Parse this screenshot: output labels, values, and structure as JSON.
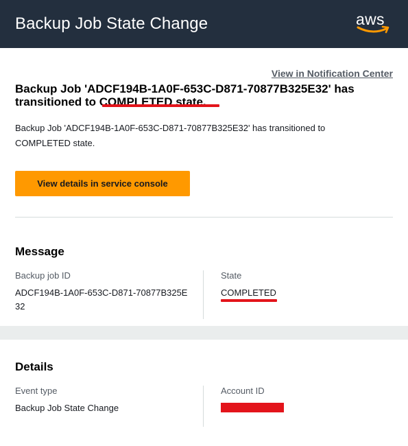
{
  "header": {
    "title": "Backup Job State Change",
    "logo_text": "aws"
  },
  "notification_link": "View in Notification Center",
  "headline": {
    "prefix": "Backup Job 'ADCF194B-1A0F-653C-D871-70877B325E32' has transitioned to ",
    "state_phrase": "COMPLETED state."
  },
  "body_text": "Backup Job 'ADCF194B-1A0F-653C-D871-70877B325E32' has transitioned to COMPLETED state.",
  "cta_button": "View details in service console",
  "message": {
    "title": "Message",
    "backup_job_id_label": "Backup job ID",
    "backup_job_id_value": "ADCF194B-1A0F-653C-D871-70877B325E32",
    "state_label": "State",
    "state_value": "COMPLETED"
  },
  "details": {
    "title": "Details",
    "event_type_label": "Event type",
    "event_type_value": "Backup Job State Change",
    "account_id_label": "Account ID"
  },
  "colors": {
    "header_bg": "#232f3e",
    "accent_orange": "#ff9900",
    "redaction_red": "#e3141b"
  }
}
